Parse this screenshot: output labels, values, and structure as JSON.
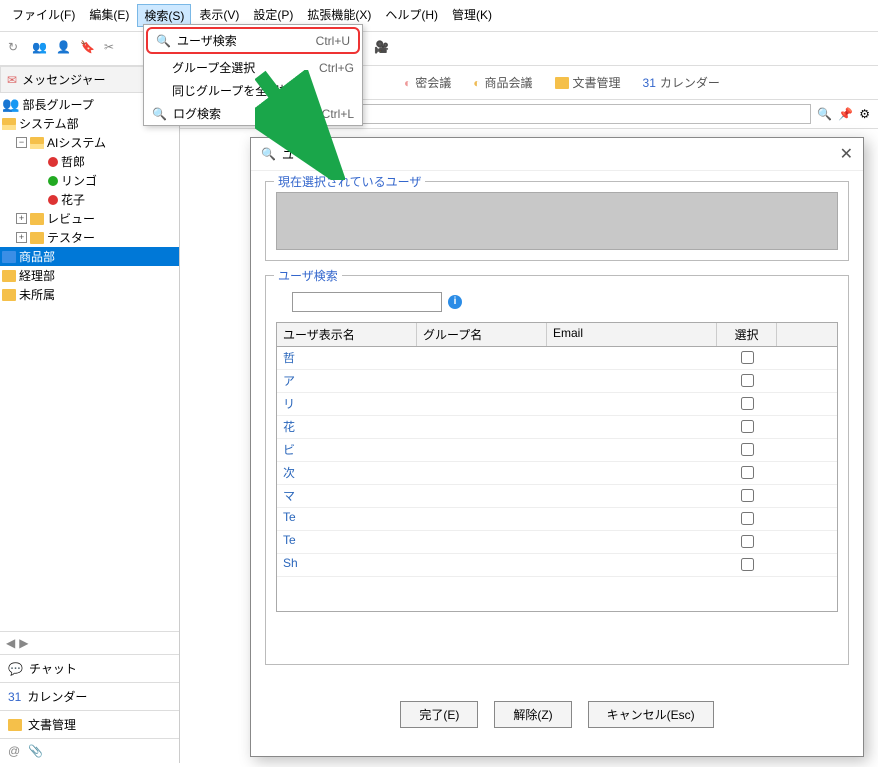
{
  "menubar": {
    "file": "ファイル(F)",
    "edit": "編集(E)",
    "search": "検索(S)",
    "view": "表示(V)",
    "settings": "設定(P)",
    "extensions": "拡張機能(X)",
    "help": "ヘルプ(H)",
    "admin": "管理(K)"
  },
  "dropdown": {
    "user_search": "ユーザ検索",
    "user_search_sc": "Ctrl+U",
    "group_all": "グループ全選択",
    "group_all_sc": "Ctrl+G",
    "same_group": "同じグループを全選択",
    "log_search": "ログ検索",
    "log_search_sc": "Ctrl+L"
  },
  "sidebar": {
    "messenger": "メッセンジャー",
    "tree": {
      "bucho_group": "部長グループ",
      "system": "システム部",
      "ai_system": "AIシステム",
      "tetsuro": "哲郎",
      "ringo": "リンゴ",
      "hanako": "花子",
      "review": "レビュー",
      "tester": "テスター",
      "products": "商品部",
      "accounting": "経理部",
      "unassigned": "未所属"
    },
    "chat": "チャット",
    "calendar": "カレンダー",
    "docs": "文書管理"
  },
  "tabs": {
    "secret": "密会議",
    "product": "商品会議",
    "docs": "文書管理",
    "calendar": "カレンダー"
  },
  "dialog": {
    "title_prefix": "ユ",
    "selected_legend": "現在選択されているユーザ",
    "search_legend": "ユーザ検索",
    "col_name": "ユーザ表示名",
    "col_group": "グループ名",
    "col_email": "Email",
    "col_select": "選択",
    "rows": [
      {
        "name": "哲"
      },
      {
        "name": "ア"
      },
      {
        "name": "リ"
      },
      {
        "name": "花"
      },
      {
        "name": "ビ"
      },
      {
        "name": "次"
      },
      {
        "name": "マ"
      },
      {
        "name": "Te"
      },
      {
        "name": "Te"
      },
      {
        "name": "Sh"
      }
    ],
    "btn_done": "完了(E)",
    "btn_release": "解除(Z)",
    "btn_cancel": "キャンセル(Esc)"
  }
}
